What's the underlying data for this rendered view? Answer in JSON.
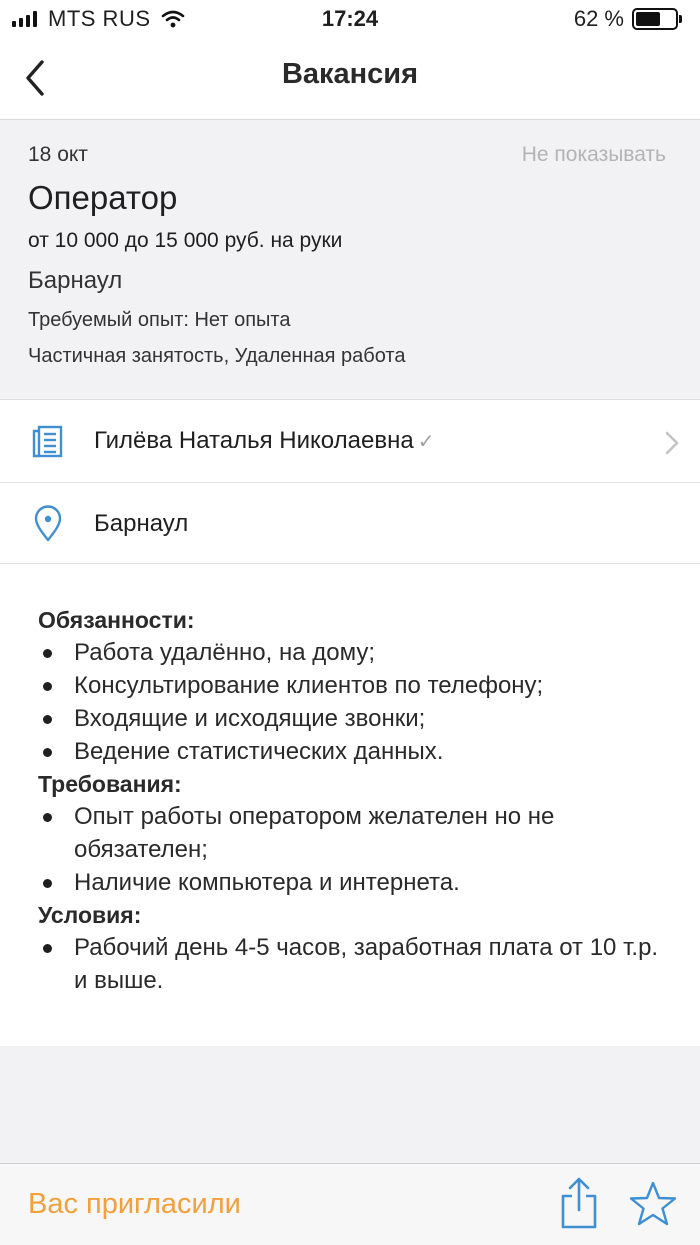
{
  "status_bar": {
    "carrier": "MTS RUS",
    "time": "17:24",
    "battery_percent_label": "62 %",
    "battery_level": 0.62
  },
  "nav": {
    "back_icon": "chevron-left-icon",
    "title": "Вакансия"
  },
  "vacancy": {
    "date": "18 окт",
    "hide_label": "Не показывать",
    "title": "Оператор",
    "salary": "от 10 000 до 15 000 руб. на руки",
    "city": "Барнаул",
    "experience": "Требуемый опыт: Нет опыта",
    "employment": "Частичная занятость, Удаленная работа"
  },
  "info_rows": {
    "employer": {
      "name": "Гилёва Наталья Николаевна",
      "verified_mark": "✓",
      "icon": "building-icon"
    },
    "location": {
      "name": "Барнаул",
      "icon": "location-pin-icon"
    }
  },
  "description": {
    "duties_heading": "Обязанности:",
    "duties": [
      "Работа удалённо, на дому;",
      "Консультирование клиентов по телефону;",
      "Входящие и исходящие звонки;",
      "Ведение статистических данных."
    ],
    "requirements_heading": "Требования:",
    "requirements": [
      "Опыт работы оператором желателен но не обязателен;",
      "Наличие компьютера и интернета."
    ],
    "conditions_heading": "Условия:",
    "conditions": [
      "Рабочий день 4-5 часов, заработная плата от 10 т.р. и выше."
    ]
  },
  "bottom_bar": {
    "status": "Вас пригласили",
    "share_icon": "share-icon",
    "favorite_icon": "star-icon"
  },
  "colors": {
    "accent_blue": "#3f8fd2",
    "invited_orange": "#f2a03d",
    "muted_gray": "#b3b3b3"
  }
}
